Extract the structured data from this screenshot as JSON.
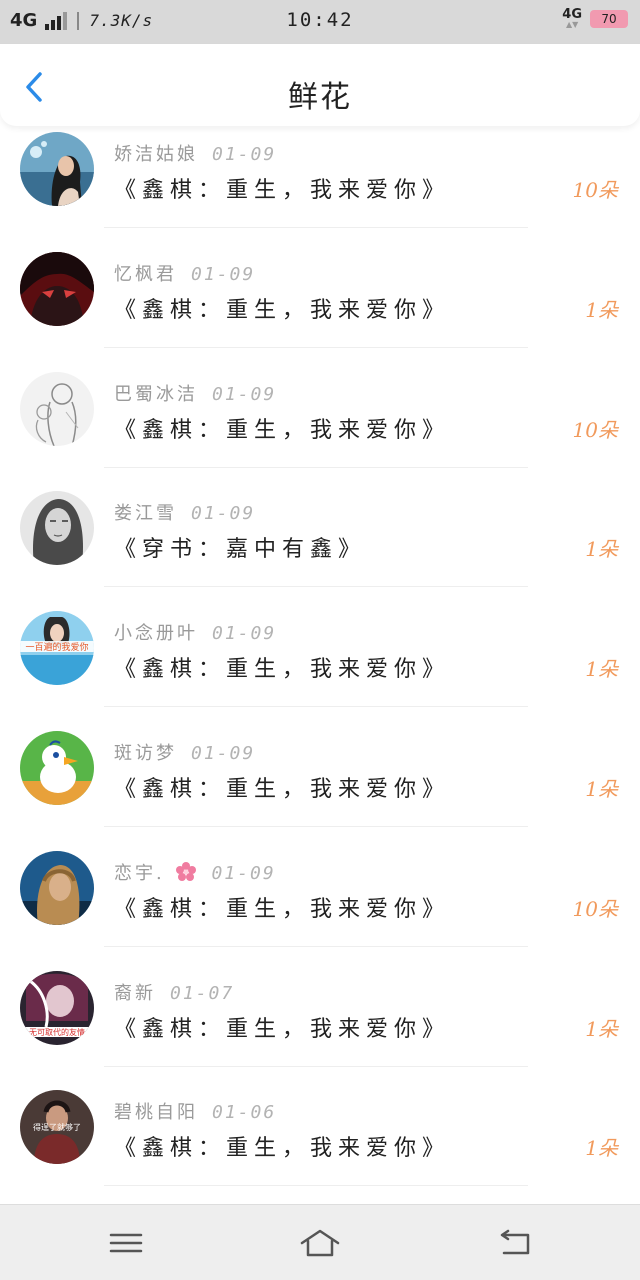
{
  "status_bar": {
    "network": "4G",
    "speed": "7.3K/s",
    "time": "10:42",
    "network_right": "4G",
    "battery": "70"
  },
  "header": {
    "title": "鲜花"
  },
  "colors": {
    "accent_blue": "#2b8be8",
    "count_orange": "#f19a5c"
  },
  "items": [
    {
      "name": "娇洁姑娘",
      "date": "01-09",
      "book": "《鑫棋：重生，我来爱你》",
      "count": "10朵"
    },
    {
      "name": "忆枫君",
      "date": "01-09",
      "book": "《鑫棋：重生，我来爱你》",
      "count": "1朵"
    },
    {
      "name": "巴蜀冰洁",
      "date": "01-09",
      "book": "《鑫棋：重生，我来爱你》",
      "count": "10朵"
    },
    {
      "name": "娄江雪",
      "date": "01-09",
      "book": "《穿书：嘉中有鑫》",
      "count": "1朵"
    },
    {
      "name": "小念册叶",
      "date": "01-09",
      "book": "《鑫棋：重生，我来爱你》",
      "count": "1朵"
    },
    {
      "name": "斑访梦",
      "date": "01-09",
      "book": "《鑫棋：重生，我来爱你》",
      "count": "1朵"
    },
    {
      "name": "恋宇.",
      "date": "01-09",
      "book": "《鑫棋：重生，我来爱你》",
      "count": "10朵"
    },
    {
      "name": "裔新",
      "date": "01-07",
      "book": "《鑫棋：重生，我来爱你》",
      "count": "1朵"
    },
    {
      "name": "碧桃自阳",
      "date": "01-06",
      "book": "《鑫棋：重生，我来爱你》",
      "count": "1朵"
    }
  ],
  "avatar_labels": {
    "a5": "一百遍的我爱你",
    "a8": "无可取代的友情",
    "a9": "得逞了就够了"
  },
  "icons": {
    "back": "chevron-left-icon",
    "menu": "menu-icon",
    "home": "home-icon",
    "back_nav": "back-arrow-icon",
    "flower": "cherry-blossom-icon"
  }
}
